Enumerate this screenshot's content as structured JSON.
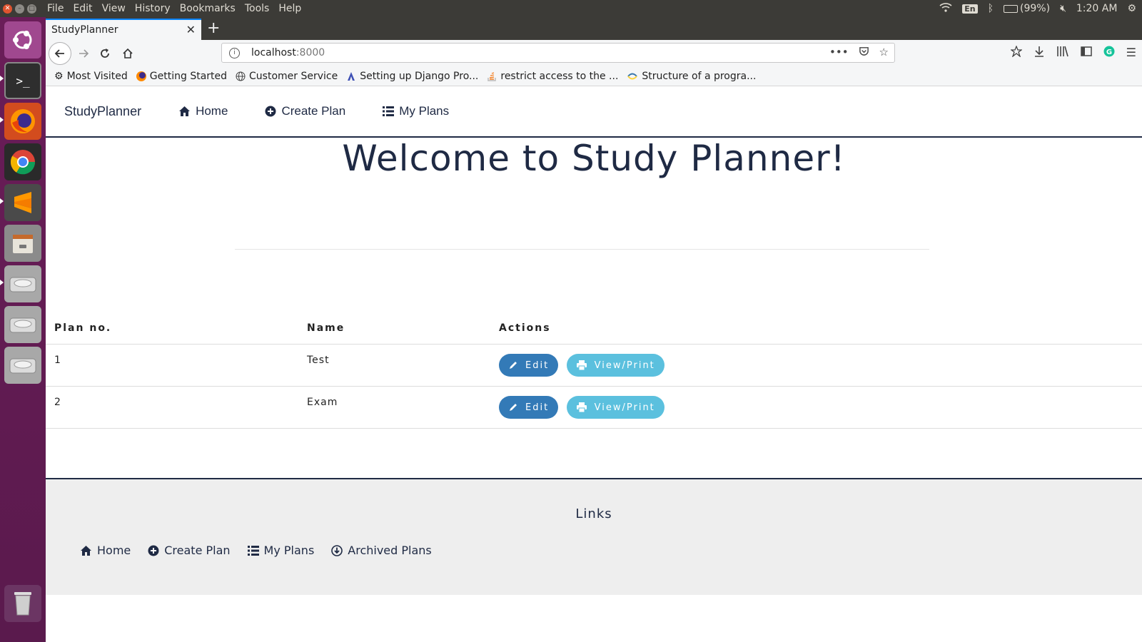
{
  "os": {
    "menus": [
      "File",
      "Edit",
      "View",
      "History",
      "Bookmarks",
      "Tools",
      "Help"
    ],
    "lang": "En",
    "battery": "(99%)",
    "time": "1:20 AM"
  },
  "browser": {
    "tab_title": "StudyPlanner",
    "url_host": "localhost",
    "url_port": ":8000",
    "bookmarks": [
      {
        "label": "Most Visited",
        "icon": "gear-icon"
      },
      {
        "label": "Getting Started",
        "icon": "firefox-icon"
      },
      {
        "label": "Customer Service",
        "icon": "globe-icon"
      },
      {
        "label": "Setting up Django Pro...",
        "icon": "django-icon"
      },
      {
        "label": "restrict access to the ...",
        "icon": "stackoverflow-icon"
      },
      {
        "label": "Structure of a progra...",
        "icon": "python-icon"
      }
    ]
  },
  "site": {
    "brand": "StudyPlanner",
    "nav": [
      {
        "label": "Home",
        "icon": "home-icon"
      },
      {
        "label": "Create Plan",
        "icon": "plus-circle-icon"
      },
      {
        "label": "My Plans",
        "icon": "list-icon"
      }
    ],
    "welcome": "Welcome to Study Planner!",
    "table": {
      "headers": [
        "Plan no.",
        "Name",
        "Actions"
      ],
      "rows": [
        {
          "no": "1",
          "name": "Test",
          "edit": "Edit",
          "view": "View/Print"
        },
        {
          "no": "2",
          "name": "Exam",
          "edit": "Edit",
          "view": "View/Print"
        }
      ]
    },
    "footer": {
      "title": "Links",
      "links": [
        {
          "label": "Home",
          "icon": "home-icon"
        },
        {
          "label": "Create Plan",
          "icon": "plus-circle-icon"
        },
        {
          "label": "My Plans",
          "icon": "list-icon"
        },
        {
          "label": "Archived Plans",
          "icon": "download-circle-icon"
        }
      ]
    }
  },
  "colors": {
    "primary_text": "#1f2a44",
    "edit_button": "#337ab7",
    "view_button": "#5bc0de",
    "launcher": "#5e1c4f"
  }
}
